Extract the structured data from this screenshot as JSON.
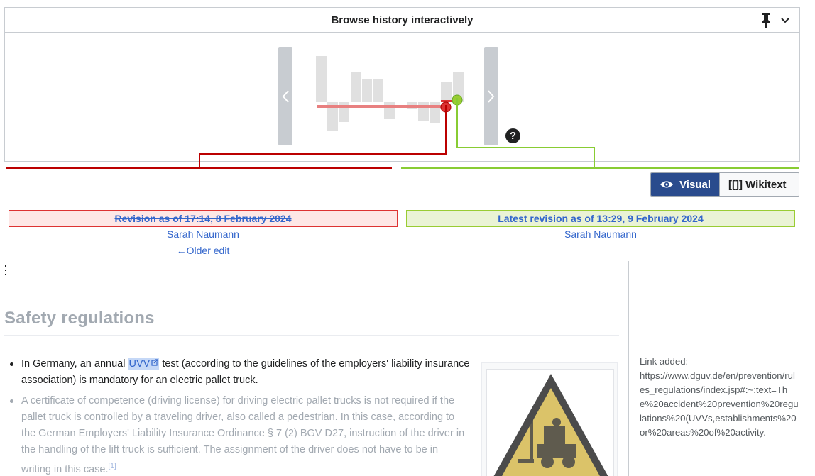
{
  "history_panel": {
    "title": "Browse history interactively",
    "pin_icon": "pin-icon",
    "collapse_icon": "chevron-down-icon",
    "help_label": "?"
  },
  "view_toggle": {
    "visual_label": "Visual",
    "wikitext_label": "[[]] Wikitext",
    "active": "visual"
  },
  "old_revision": {
    "title": "Revision as of 17:14, 8 February 2024",
    "user": "Sarah Naumann",
    "older_edit_label": "←Older edit"
  },
  "new_revision": {
    "title": "Latest revision as of 13:29, 9 February 2024",
    "user": "Sarah Naumann"
  },
  "content": {
    "section_heading": "Safety regulations",
    "item1_before": "In Germany, an annual ",
    "item1_link": "UVV",
    "item1_after": " test (according to the guidelines of the employers' liability insurance association) is mandatory for an electric pallet truck.",
    "item2": "A certificate of competence (driving license) for driving electric pallet trucks is not required if the pallet truck is controlled by a traveling driver, also called a pedestrian. In this case, according to the German Employers' Liability Insurance Ordinance § 7 (2) BGV D27, instruction of the driver in the handling of the lift truck is sufficient. The assignment of the driver does not have to be in writing in this case.",
    "item2_ref": "[1]"
  },
  "side_note": {
    "label": "Link added:",
    "url": "https://www.dguv.de/en/prevention/rules_regulations/index.jsp#:~:text=The%20accident%20prevention%20regulations%20(UVVs,establishments%20or%20areas%20of%20activity."
  },
  "colors": {
    "removed": "#d33",
    "added": "#9c3",
    "accent": "#2a4b8d",
    "link": "#3366cc"
  }
}
